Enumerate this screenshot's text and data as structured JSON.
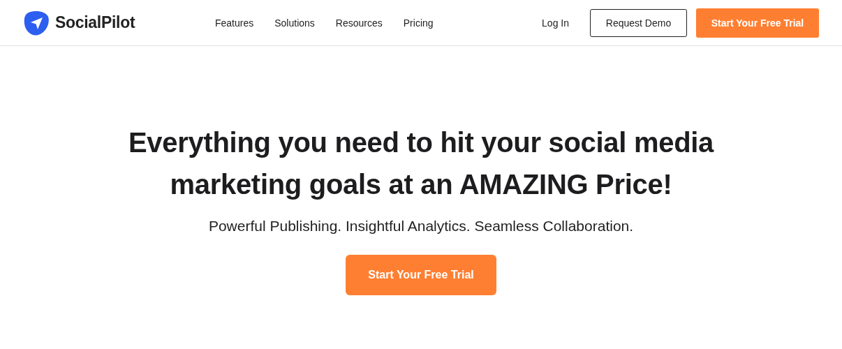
{
  "header": {
    "logo": "SocialPilot",
    "nav": [
      "Features",
      "Solutions",
      "Resources",
      "Pricing"
    ],
    "login": "Log In",
    "demo": "Request Demo",
    "trial": "Start Your Free Trial"
  },
  "hero": {
    "title_lines": [
      "Everything you need to hit your social media",
      "marketing goals at an AMAZING Price!"
    ],
    "subtitle": "Powerful Publishing. Insightful Analytics. Seamless Collaboration.",
    "cta": "Start Your Free Trial"
  }
}
